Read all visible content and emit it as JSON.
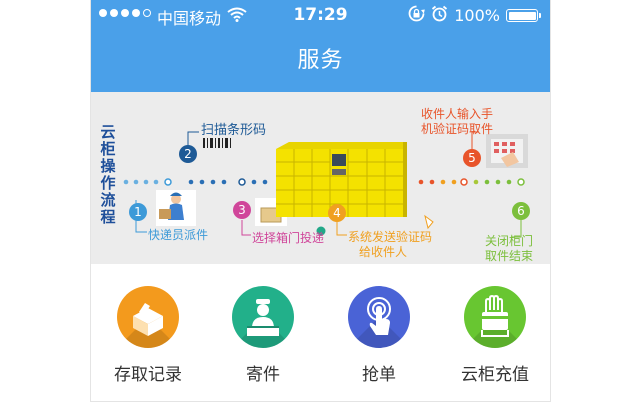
{
  "status_bar": {
    "carrier": "中国移动",
    "time": "17:29",
    "battery": "100%",
    "signal_icon": "signal-dots-icon",
    "wifi_icon": "wifi-icon",
    "rotation_lock_icon": "rotation-lock-icon",
    "alarm_icon": "alarm-icon"
  },
  "header": {
    "title": "服务",
    "color": "#4aa0e9"
  },
  "banner": {
    "vertical_title": "云柜操作流程",
    "steps": [
      {
        "num": "1",
        "label": "快递员派件",
        "color": "#3d9ad8"
      },
      {
        "num": "2",
        "label": "扫描条形码",
        "color": "#1e5a96"
      },
      {
        "num": "3",
        "label": "选择箱门投递",
        "color": "#d0469a"
      },
      {
        "num": "4",
        "label_line1": "系统发送验证码",
        "label_line2": "给收件人",
        "color": "#f0a020"
      },
      {
        "num": "5",
        "label_line1": "收件人输入手",
        "label_line2": "机验证码取件",
        "color": "#e8542a"
      },
      {
        "num": "6",
        "label_line1": "关闭柜门",
        "label_line2": "取件结束",
        "color": "#7cbf3c"
      }
    ]
  },
  "menu": [
    {
      "label": "存取记录",
      "icon": "parcel-box-icon",
      "color": "#f39a1d"
    },
    {
      "label": "寄件",
      "icon": "courier-desk-icon",
      "color": "#22b08a"
    },
    {
      "label": "抢单",
      "icon": "tap-finger-icon",
      "color": "#4a63d6"
    },
    {
      "label": "云柜充值",
      "icon": "hand-card-icon",
      "color": "#68c631"
    }
  ]
}
